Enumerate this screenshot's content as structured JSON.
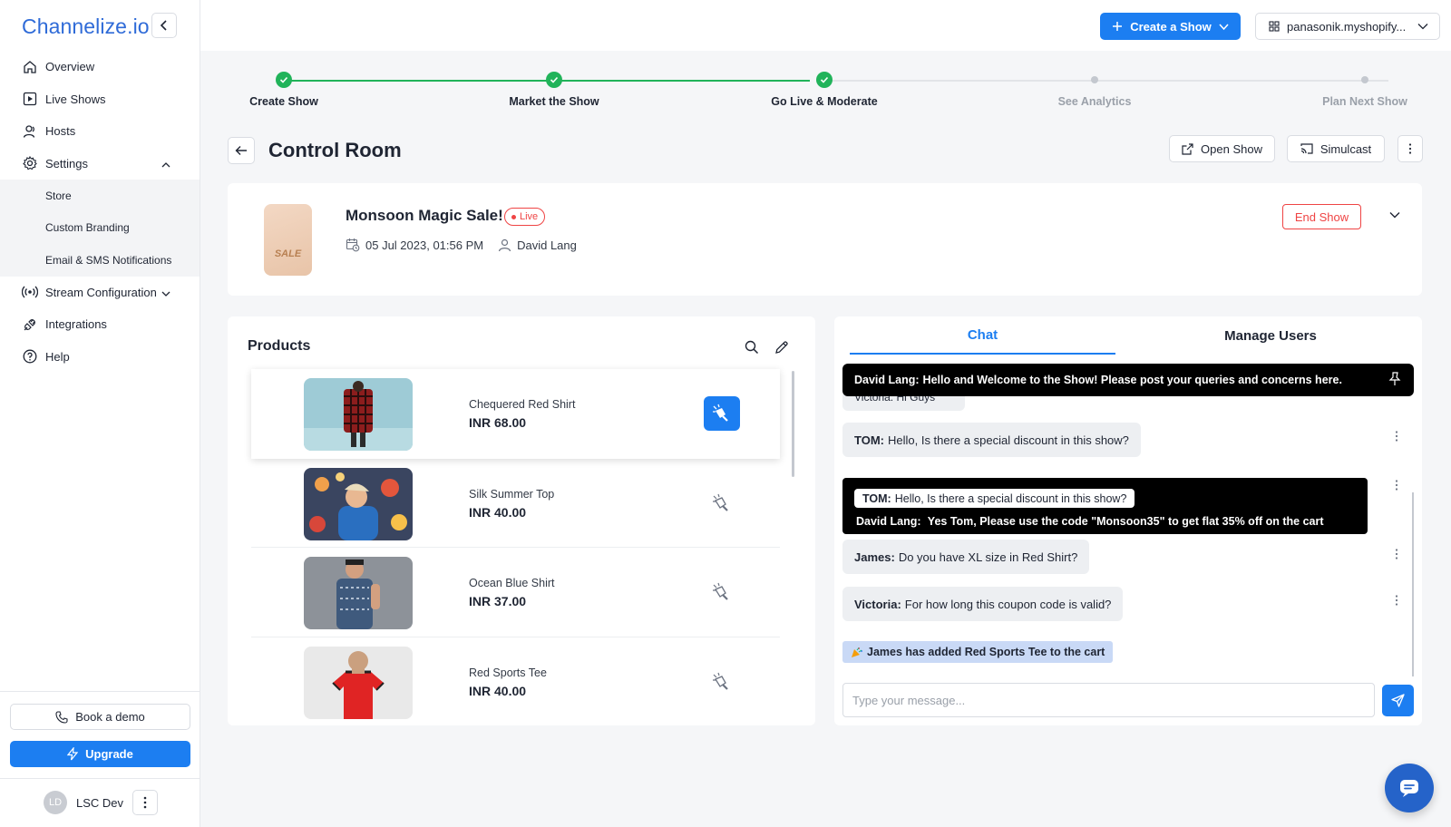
{
  "brand": {
    "name": "Channelize.io"
  },
  "sidebar": {
    "items": [
      {
        "label": "Overview",
        "icon": "home-icon"
      },
      {
        "label": "Live Shows",
        "icon": "play-square-icon"
      },
      {
        "label": "Hosts",
        "icon": "hosts-icon"
      },
      {
        "label": "Settings",
        "icon": "gear-icon"
      },
      {
        "label": "Stream Configuration",
        "icon": "broadcast-icon"
      },
      {
        "label": "Integrations",
        "icon": "plug-icon"
      },
      {
        "label": "Help",
        "icon": "help-icon"
      }
    ],
    "settings_sub": [
      "Store",
      "Custom Branding",
      "Email & SMS Notifications"
    ],
    "book_demo": "Book a demo",
    "upgrade": "Upgrade",
    "user": {
      "initials": "LD",
      "name": "LSC Dev"
    }
  },
  "header": {
    "create_show": "Create a Show",
    "store": "panasonik.myshopify..."
  },
  "stepper": {
    "steps": [
      {
        "label": "Create Show",
        "done": true
      },
      {
        "label": "Market the Show",
        "done": true
      },
      {
        "label": "Go Live & Moderate",
        "done": true
      },
      {
        "label": "See Analytics",
        "done": false
      },
      {
        "label": "Plan Next Show",
        "done": false
      }
    ]
  },
  "page": {
    "title": "Control Room",
    "open_show": "Open Show",
    "simulcast": "Simulcast"
  },
  "show": {
    "name": "Monsoon Magic Sale!",
    "status": "Live",
    "datetime": "05 Jul 2023, 01:56 PM",
    "host": "David Lang",
    "end_show": "End Show",
    "thumb_text": "SALE"
  },
  "products": {
    "title": "Products",
    "items": [
      {
        "name": "Chequered Red Shirt",
        "price": "INR 68.00",
        "spotlight": true
      },
      {
        "name": "Silk Summer Top",
        "price": "INR 40.00",
        "spotlight": false
      },
      {
        "name": "Ocean Blue Shirt",
        "price": "INR 37.00",
        "spotlight": false
      },
      {
        "name": "Red Sports Tee",
        "price": "INR 40.00",
        "spotlight": false
      }
    ]
  },
  "chat": {
    "tabs": {
      "chat": "Chat",
      "manage_users": "Manage Users"
    },
    "pinned": {
      "author": "David Lang:",
      "text": "Hello and Welcome to the Show! Please post your queries and concerns here."
    },
    "partial": "Victoria: Hi Guys",
    "messages": [
      {
        "author": "TOM:",
        "text": "Hello, Is there a special discount in this show?"
      },
      {
        "author": "James:",
        "text": "Do you have XL size in Red Shirt?"
      },
      {
        "author": "Victoria:",
        "text": "For how long this coupon code is valid?"
      }
    ],
    "reply": {
      "quote_author": "TOM:",
      "quote_text": "Hello, Is there a special discount in this show?",
      "author": "David Lang:",
      "text": "Yes Tom, Please use the code \"Monsoon35\" to get flat 35% off on the cart"
    },
    "cart_note": "James has added Red Sports Tee to the cart",
    "placeholder": "Type your message..."
  }
}
